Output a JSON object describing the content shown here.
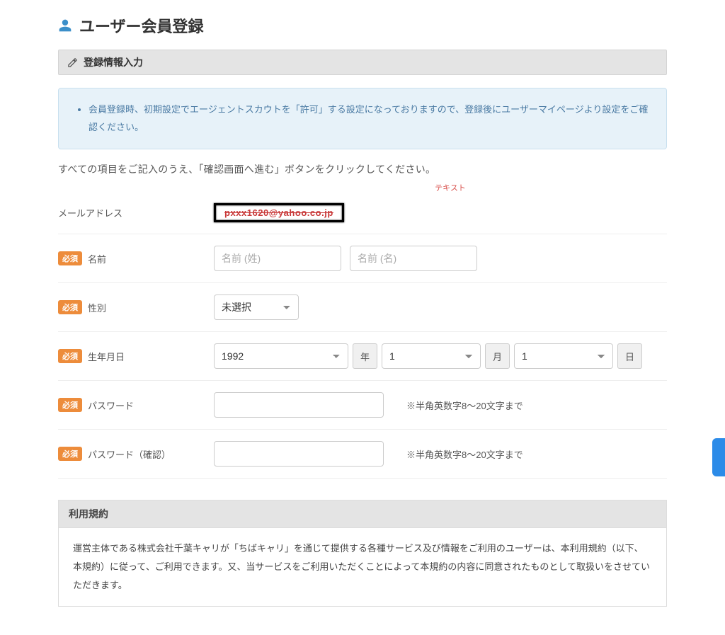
{
  "page": {
    "title": "ユーザー会員登録",
    "panel_title": "登録情報入力",
    "alert": "会員登録時、初期設定でエージェントスカウトを「許可」する設定になっておりますので、登録後にユーザーマイページより設定をご確認ください。",
    "instruction": "すべての項目をご記入のうえ、「確認画面へ進む」ボタンをクリックしてください。",
    "text_caption": "テキスト"
  },
  "labels": {
    "required": "必須",
    "email": "メールアドレス",
    "name": "名前",
    "gender": "性別",
    "birthday": "生年月日",
    "password": "パスワード",
    "password_confirm": "パスワード（確認）",
    "year_unit": "年",
    "month_unit": "月",
    "day_unit": "日"
  },
  "fields": {
    "email_value": "pxxx1620@yahoo.co.jp",
    "name_last_placeholder": "名前 (姓)",
    "name_first_placeholder": "名前 (名)",
    "gender_value": "未選択",
    "birth_year": "1992",
    "birth_month": "1",
    "birth_day": "1",
    "password_hint": "※半角英数字8〜20文字まで"
  },
  "terms": {
    "header": "利用規約",
    "body": "運営主体である株式会社千葉キャリが「ちばキャリ」を通じて提供する各種サービス及び情報をご利用のユーザーは、本利用規約（以下、本規約）に従って、ご利用できます。又、当サービスをご利用いただくことによって本規約の内容に同意されたものとして取扱いをさせていただきます。"
  }
}
